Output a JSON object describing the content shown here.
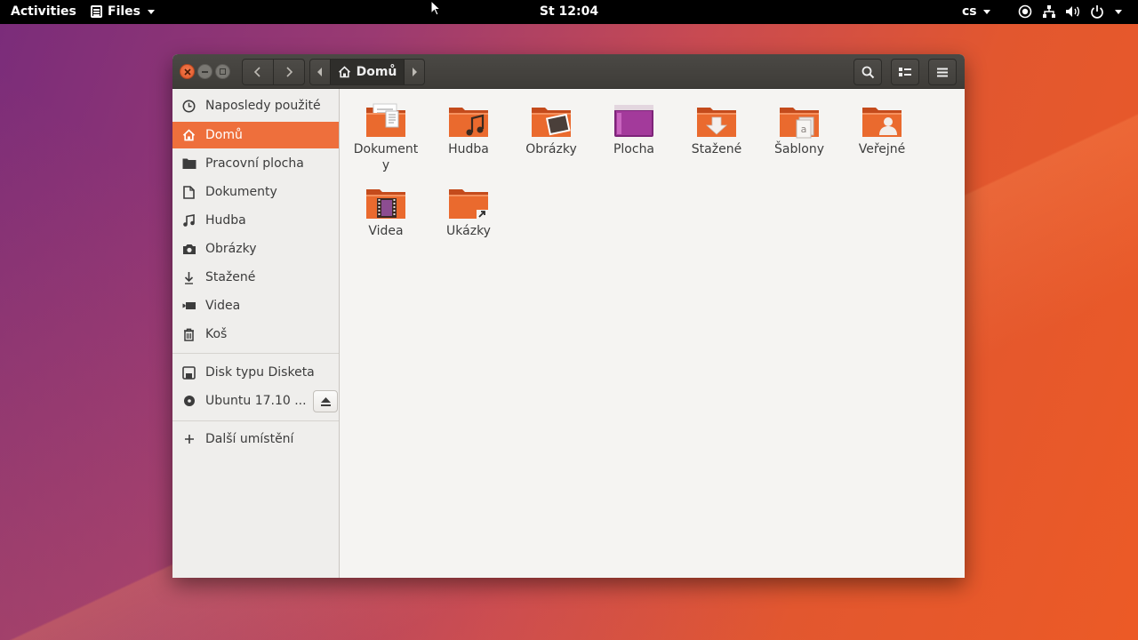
{
  "topbar": {
    "activities": "Activities",
    "app_name": "Files",
    "clock": "St 12:04",
    "language": "cs"
  },
  "window": {
    "path": {
      "current": "Domů"
    },
    "sidebar": {
      "places": [
        {
          "label": "Naposledy použité",
          "icon": "clock-icon"
        },
        {
          "label": "Domů",
          "icon": "home-icon",
          "active": true
        },
        {
          "label": "Pracovní plocha",
          "icon": "desktop-folder-icon"
        },
        {
          "label": "Dokumenty",
          "icon": "document-icon"
        },
        {
          "label": "Hudba",
          "icon": "music-icon"
        },
        {
          "label": "Obrázky",
          "icon": "camera-icon"
        },
        {
          "label": "Stažené",
          "icon": "download-icon"
        },
        {
          "label": "Videa",
          "icon": "video-icon"
        },
        {
          "label": "Koš",
          "icon": "trash-icon"
        }
      ],
      "devices": [
        {
          "label": "Disk typu Disketa",
          "icon": "floppy-icon"
        },
        {
          "label": "Ubuntu 17.10 ...",
          "icon": "optical-disc-icon"
        }
      ],
      "other_locations": "Další umístění"
    },
    "files": [
      {
        "name": "Dokumenty",
        "icon": "documents-folder-icon"
      },
      {
        "name": "Hudba",
        "icon": "music-folder-icon"
      },
      {
        "name": "Obrázky",
        "icon": "pictures-folder-icon"
      },
      {
        "name": "Plocha",
        "icon": "desktop-folder-icon"
      },
      {
        "name": "Stažené",
        "icon": "downloads-folder-icon"
      },
      {
        "name": "Šablony",
        "icon": "templates-folder-icon"
      },
      {
        "name": "Veřejné",
        "icon": "public-folder-icon"
      },
      {
        "name": "Videa",
        "icon": "videos-folder-icon"
      },
      {
        "name": "Ukázky",
        "icon": "examples-folder-link-icon"
      }
    ],
    "colors": {
      "accent": "#ee6f3c",
      "folder": "#e9642a",
      "desktop_folder": "#8b2a88"
    }
  }
}
